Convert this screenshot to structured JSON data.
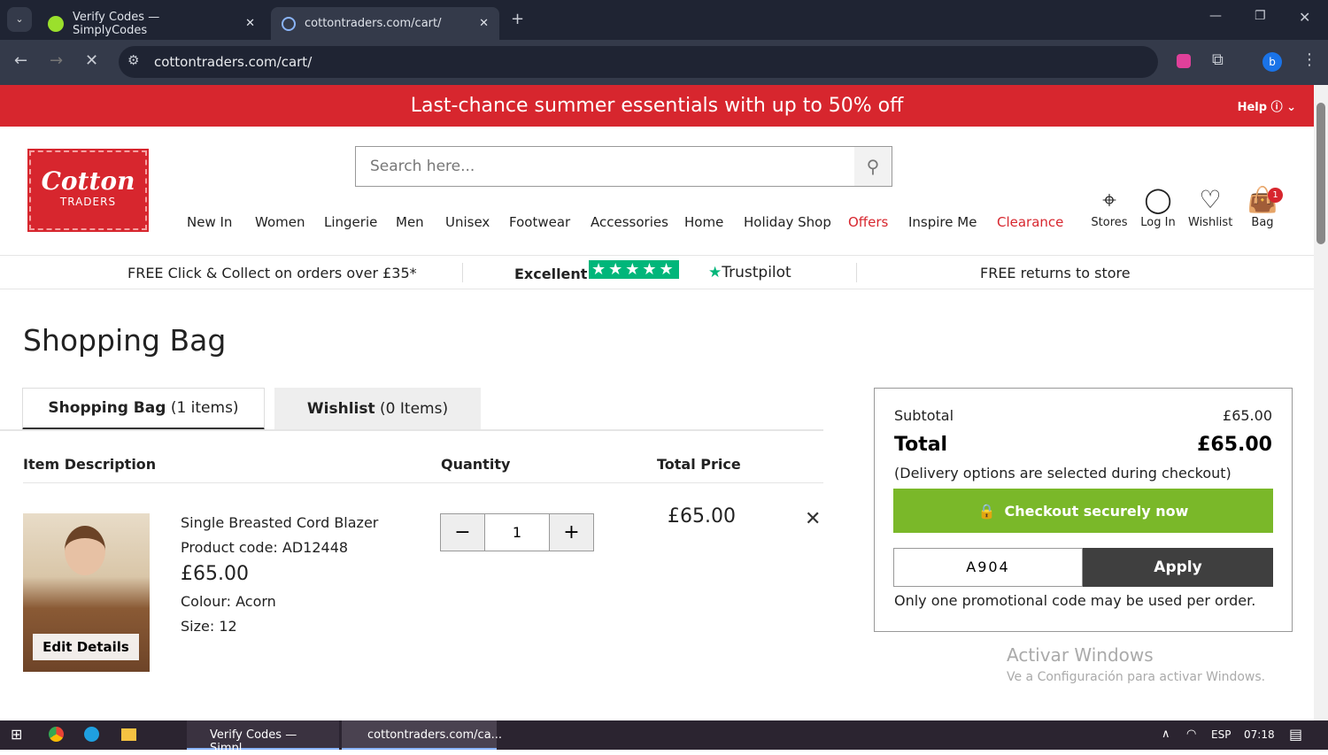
{
  "browser": {
    "tabs": [
      {
        "title": "Verify Codes — SimplyCodes"
      },
      {
        "title": "cottontraders.com/cart/"
      }
    ],
    "url": "cottontraders.com/cart/"
  },
  "promo": {
    "text": "Last-chance summer essentials with up to 50% off",
    "help": "Help"
  },
  "logo": {
    "line1": "Cotton",
    "line2": "TRADERS"
  },
  "search": {
    "placeholder": "Search here..."
  },
  "nav": [
    "New In",
    "Women",
    "Lingerie",
    "Men",
    "Unisex",
    "Footwear",
    "Accessories",
    "Home",
    "Holiday Shop",
    "Offers",
    "Inspire Me",
    "Clearance"
  ],
  "header_icons": {
    "stores": "Stores",
    "login": "Log In",
    "wishlist": "Wishlist",
    "bag": "Bag",
    "bag_count": "1"
  },
  "usp": {
    "left": "FREE Click & Collect on orders over £35*",
    "rating": "Excellent",
    "trustpilot": "Trustpilot",
    "right": "FREE returns to store"
  },
  "page_title": "Shopping Bag",
  "tabs": {
    "bag_label": "Shopping Bag",
    "bag_count": "(1 items)",
    "wish_label": "Wishlist",
    "wish_count": "(0 Items)"
  },
  "columns": {
    "desc": "Item Description",
    "qty": "Quantity",
    "total": "Total Price"
  },
  "item": {
    "name": "Single Breasted Cord Blazer",
    "code": "Product code: AD12448",
    "price": "£65.00",
    "colour": "Colour: Acorn",
    "size": "Size: 12",
    "qty": "1",
    "total": "£65.00",
    "edit": "Edit Details"
  },
  "summary": {
    "subtotal_label": "Subtotal",
    "subtotal": "£65.00",
    "total_label": "Total",
    "total": "£65.00",
    "delivery_note": "(Delivery options are selected during checkout)",
    "checkout": "Checkout securely now",
    "promo_code": "A904",
    "apply": "Apply",
    "promo_note": "Only one promotional code may be used per order."
  },
  "watermark": {
    "line1": "Activar Windows",
    "line2": "Ve a Configuración para activar Windows."
  },
  "taskbar": {
    "app1": "Verify Codes — Simpl...",
    "app2": "cottontraders.com/ca...",
    "lang": "ESP",
    "time": "07:18"
  },
  "colors": {
    "brand": "#d7262e",
    "checkout": "#7ab829",
    "apply": "#3f3f3f"
  }
}
